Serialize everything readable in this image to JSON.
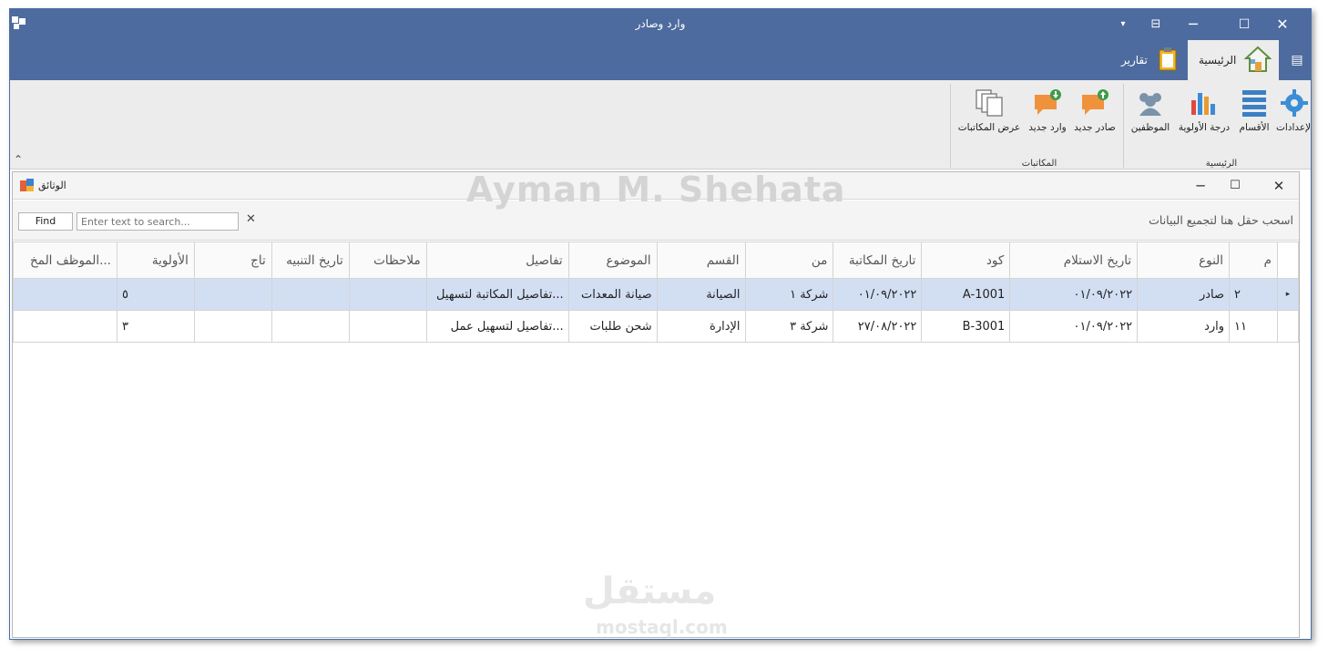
{
  "window": {
    "title": "وارد وصادر"
  },
  "ribbon": {
    "tabs": [
      {
        "label": "الرئيسية",
        "active": true
      },
      {
        "label": "تقارير",
        "active": false
      }
    ],
    "groups": [
      {
        "label": "الرئيسية",
        "buttons": [
          "الإعدادات",
          "الأقسام",
          "درجة الأولوية",
          "الموظفين"
        ]
      },
      {
        "label": "المكاتبات",
        "buttons": [
          "صادر جديد",
          "وارد جديد",
          "عرض المكاتبات"
        ]
      }
    ]
  },
  "doc": {
    "title": "الوثائق"
  },
  "watermark": "Ayman M. Shehata",
  "search": {
    "find_label": "Find",
    "placeholder": "Enter text to search...",
    "group_hint": "اسحب حقل هنا لتجميع البيانات"
  },
  "grid": {
    "columns": [
      "م",
      "النوع",
      "تاريخ الاستلام",
      "كود",
      "تاريخ المكاتبة",
      "من",
      "القسم",
      "الموضوع",
      "تفاصيل",
      "ملاحظات",
      "تاريخ التنبيه",
      "تاج",
      "الأولوية",
      "الموظف المخ..."
    ],
    "rows": [
      [
        "٢",
        "صادر",
        "٠١/٠٩/٢٠٢٢",
        "A-1001",
        "٠١/٠٩/٢٠٢٢",
        "شركة ١",
        "الصيانة",
        "صيانة المعدات",
        "تفاصيل المكاتبة لتسهيل...",
        "",
        "",
        "",
        "٥",
        ""
      ],
      [
        "١١",
        "وارد",
        "٠١/٠٩/٢٠٢٢",
        "B-3001",
        "٢٧/٠٨/٢٠٢٢",
        "شركة ٣",
        "الإدارة",
        "شحن طلبات",
        "تفاصيل لتسهيل عمل...",
        "",
        "",
        "",
        "٣",
        ""
      ]
    ],
    "selected_row": 0
  },
  "footer_watermark": {
    "arabic": "مستقل",
    "latin": "mostaql.com"
  },
  "colors": {
    "title_bar": "#4d6b9e",
    "ribbon_bg": "#ececec",
    "selected_row": "#d2dff3"
  },
  "icons": [
    "app-icon",
    "pin-icon",
    "restore-icon",
    "maximize-icon",
    "close-icon",
    "home-icon",
    "clipboard-icon",
    "gear-icon",
    "list-icon",
    "bar-chart-icon",
    "people-icon",
    "chat-up-icon",
    "chat-down-icon",
    "copy-icon"
  ]
}
